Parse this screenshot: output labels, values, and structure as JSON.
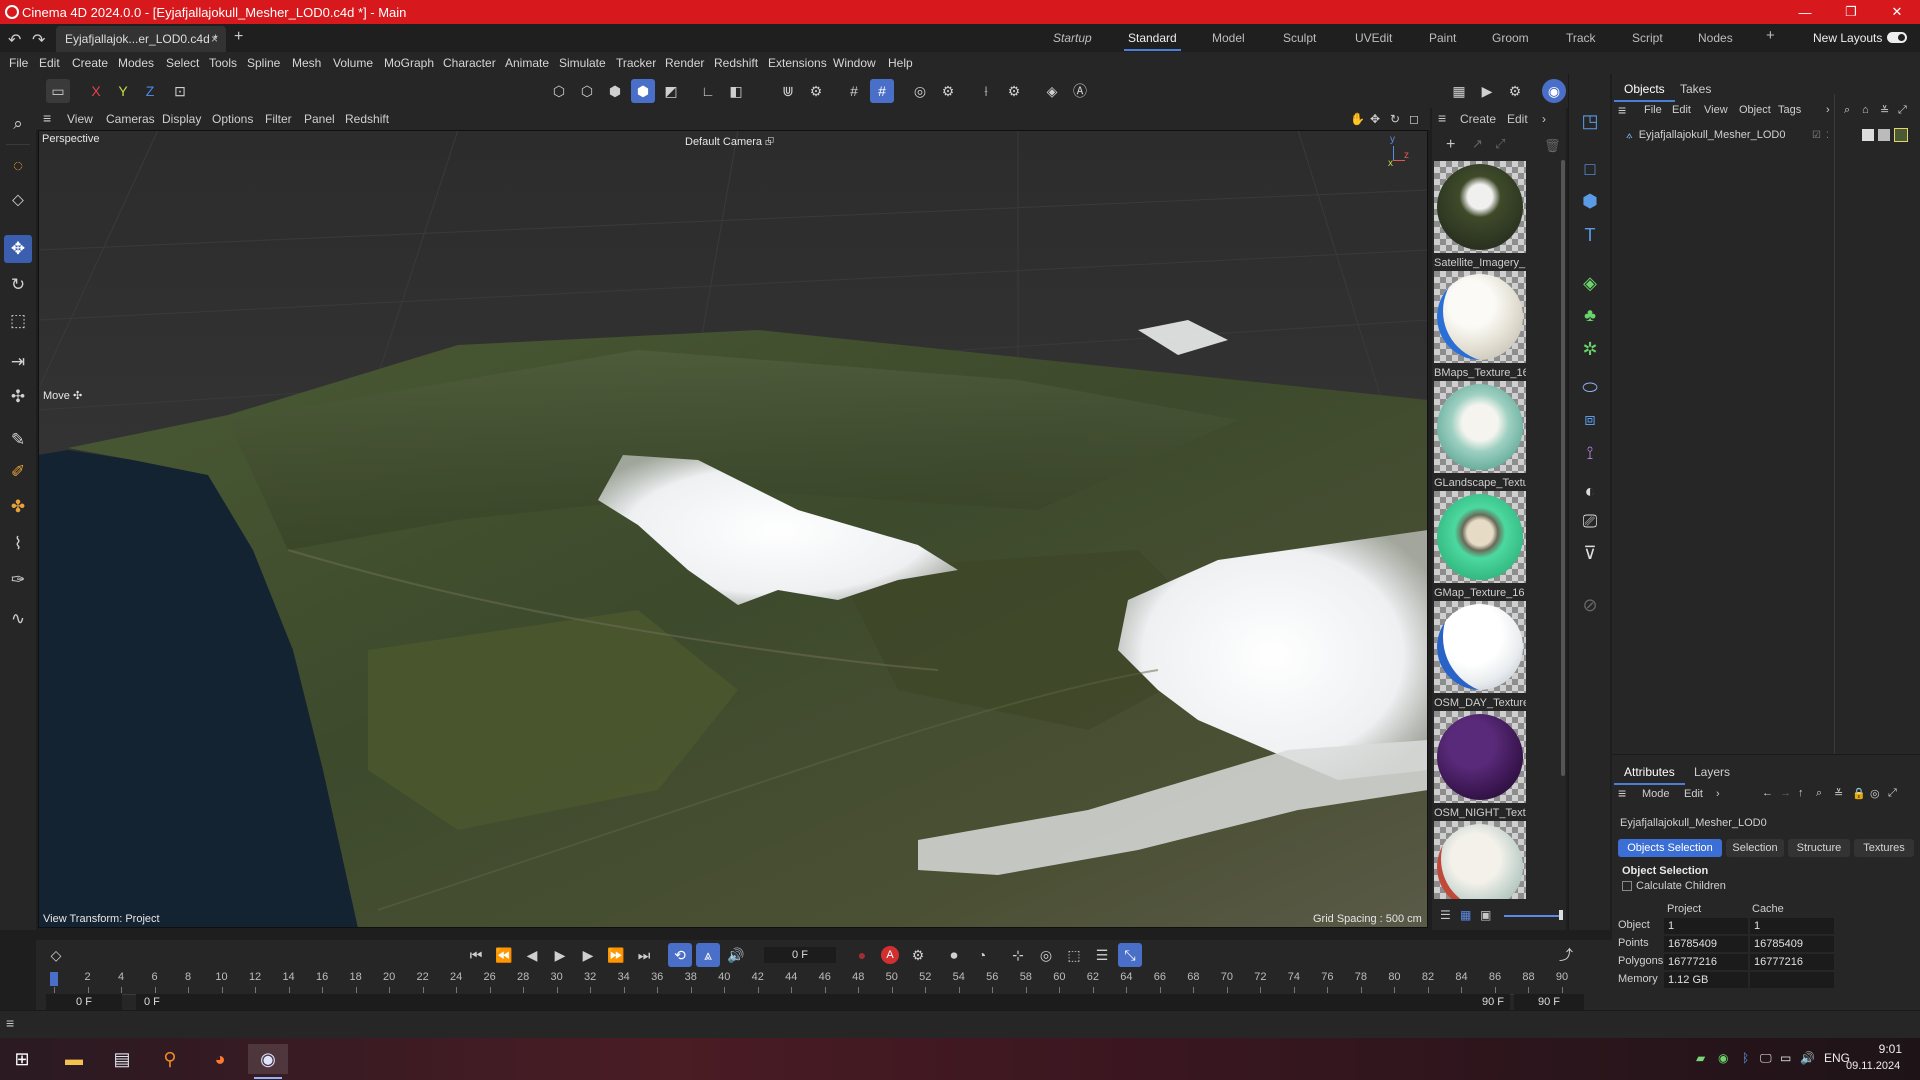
{
  "window": {
    "title": "Cinema 4D 2024.0.0 - [Eyjafjallajokull_Mesher_LOD0.c4d *] - Main",
    "minimize": "—",
    "maximize": "❐",
    "close": "✕"
  },
  "doc_tab": {
    "label": "Eyjafjallajok...er_LOD0.c4d *",
    "close": "×"
  },
  "layouts": [
    "Startup",
    "Standard",
    "Model",
    "Sculpt",
    "UVEdit",
    "Paint",
    "Groom",
    "Track",
    "Script",
    "Nodes"
  ],
  "layouts_active": "Standard",
  "new_layouts": "New Layouts",
  "menu": [
    "File",
    "Edit",
    "Create",
    "Modes",
    "Select",
    "Tools",
    "Spline",
    "Mesh",
    "Volume",
    "MoGraph",
    "Character",
    "Animate",
    "Simulate",
    "Tracker",
    "Render",
    "Redshift",
    "Extensions",
    "Window",
    "Help"
  ],
  "axis_buttons": {
    "x": "X",
    "y": "Y",
    "z": "Z"
  },
  "viewport": {
    "menu": [
      "View",
      "Cameras",
      "Display",
      "Options",
      "Filter",
      "Panel",
      "Redshift"
    ],
    "view_name": "Perspective",
    "camera": "Default Camera",
    "camera_icon": "⮺",
    "tool_hint": "Move ✣",
    "view_transform": "View Transform: Project",
    "grid_spacing": "Grid Spacing : 500 cm",
    "axis_y": "y",
    "axis_z": "z",
    "axis_x": "x"
  },
  "materials": {
    "menu": [
      "Create",
      "Edit"
    ],
    "items": [
      {
        "name": "Satellite_Imagery_"
      },
      {
        "name": "BMaps_Texture_16"
      },
      {
        "name": "GLandscape_Textu"
      },
      {
        "name": "GMap_Texture_16"
      },
      {
        "name": "OSM_DAY_Texture"
      },
      {
        "name": "OSM_NIGHT_Textu"
      },
      {
        "name": ""
      }
    ]
  },
  "objects_panel": {
    "tabs": [
      "Objects",
      "Takes"
    ],
    "menu": [
      "File",
      "Edit",
      "View",
      "Object",
      "Tags"
    ],
    "object_name": "Eyjafjallajokull_Mesher_LOD0"
  },
  "attributes": {
    "tabs": [
      "Attributes",
      "Layers"
    ],
    "menu": [
      "Mode",
      "Edit"
    ],
    "object_name": "Eyjafjallajokull_Mesher_LOD0",
    "buttons": [
      "Objects Selection",
      "Selection",
      "Structure",
      "Textures"
    ],
    "section": "Object Selection",
    "calculate_children": "Calculate Children",
    "col_project": "Project",
    "col_cache": "Cache",
    "rows": [
      {
        "label": "Object",
        "project": "1",
        "cache": "1"
      },
      {
        "label": "Points",
        "project": "16785409",
        "cache": "16785409"
      },
      {
        "label": "Polygons",
        "project": "16777216",
        "cache": "16777216"
      },
      {
        "label": "Memory",
        "project": "1.12 GB",
        "cache": ""
      }
    ]
  },
  "timeline": {
    "current_frame": "0 F",
    "ticks": [
      "0",
      "2",
      "4",
      "6",
      "8",
      "10",
      "12",
      "14",
      "16",
      "18",
      "20",
      "22",
      "24",
      "26",
      "28",
      "30",
      "32",
      "34",
      "36",
      "38",
      "40",
      "42",
      "44",
      "46",
      "48",
      "50",
      "52",
      "54",
      "56",
      "58",
      "60",
      "62",
      "64",
      "66",
      "68",
      "70",
      "72",
      "74",
      "76",
      "78",
      "80",
      "82",
      "84",
      "86",
      "88",
      "90"
    ],
    "start_a": "0 F",
    "start_b": "0 F",
    "end_a": "90 F",
    "end_b": "90 F",
    "record_label": "A"
  },
  "taskbar": {
    "lang": "ENG",
    "time": "9:01",
    "date": "09.11.2024"
  },
  "colors": {
    "titlebar": "#d7191d",
    "accent": "#4a6fc9",
    "panel": "#262626"
  }
}
